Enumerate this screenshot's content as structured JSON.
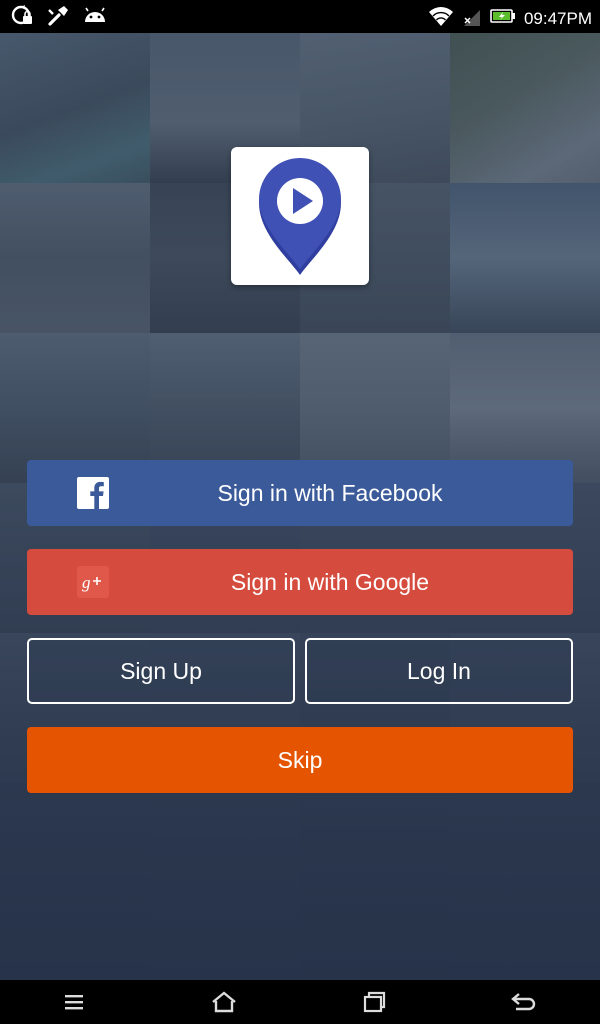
{
  "status_bar": {
    "time": "09:47PM",
    "left_icons": [
      "sync-lock-icon",
      "wrench-icon",
      "android-icon"
    ],
    "right_icons": [
      "wifi-icon",
      "signal-icon",
      "battery-charging-icon"
    ]
  },
  "app": {
    "logo_icon": "map-pin-play-icon",
    "brand_color": "#3f51b5"
  },
  "auth": {
    "facebook_label": "Sign in with Facebook",
    "google_label": "Sign in with Google",
    "signup_label": "Sign Up",
    "login_label": "Log In",
    "skip_label": "Skip"
  },
  "colors": {
    "facebook": "#3b5a9a",
    "google": "#d54b3d",
    "skip": "#e55400"
  },
  "nav_bar": {
    "icons": [
      "menu-icon",
      "home-icon",
      "recent-apps-icon",
      "back-icon"
    ]
  }
}
